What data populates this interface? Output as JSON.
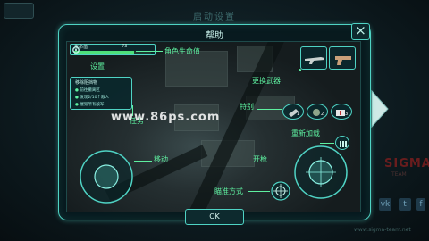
{
  "background": {
    "title": "启动设置"
  },
  "dialog": {
    "title": "帮助",
    "ok_label": "OK"
  },
  "hud": {
    "health_label": "生命值",
    "health_value": "73",
    "health_level": 0.78,
    "mission_title": "移除阻挡物",
    "mission_items": [
      "前往撤离区",
      "发现2/10个敌人",
      "摧毁所有敌军"
    ],
    "item_counts": [
      "1",
      "2",
      "3"
    ]
  },
  "labels": {
    "health": "角色生命值",
    "settings": "设置",
    "switch_weapon": "更换武器",
    "special": "特别",
    "mission": "任务",
    "reload": "重新加载",
    "move": "移动",
    "fire": "开枪",
    "aim": "瞄准方式"
  },
  "watermark": "www.86ps.com",
  "brand": {
    "name": "SIGMA",
    "sub": "TEAM",
    "url": "www.sigma-team.net"
  },
  "colors": {
    "accent": "#4fd3c4",
    "label": "#5ef0a0",
    "health": "#4ee07a"
  }
}
